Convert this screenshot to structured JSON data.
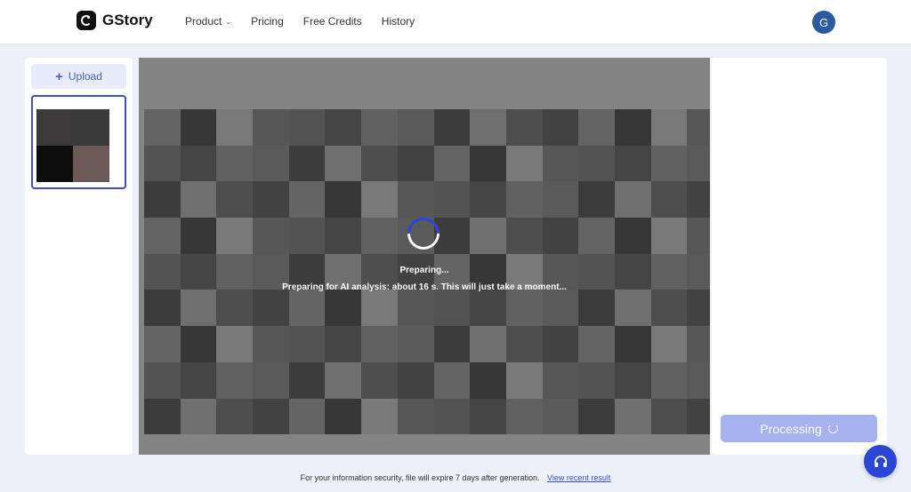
{
  "header": {
    "brand": "GStory",
    "nav": [
      {
        "label": "Product",
        "has_dropdown": true
      },
      {
        "label": "Pricing"
      },
      {
        "label": "Free Credits"
      },
      {
        "label": "History"
      }
    ],
    "avatar_initial": "G",
    "avatar_color": "#2b5a9e"
  },
  "sidebar": {
    "upload_label": "Upload"
  },
  "preview": {
    "status_title": "Preparing...",
    "status_message": "Preparing for AI analysis: about 16 s. This will just take a moment..."
  },
  "actions": {
    "process_label": "Processing"
  },
  "footer": {
    "notice": "For your information security, file will expire 7 days after generation.",
    "link": "View recent result"
  },
  "colors": {
    "accent": "#2b45d6",
    "button_disabled": "#a8b1f0"
  },
  "icons": {
    "support": "headset-icon"
  }
}
